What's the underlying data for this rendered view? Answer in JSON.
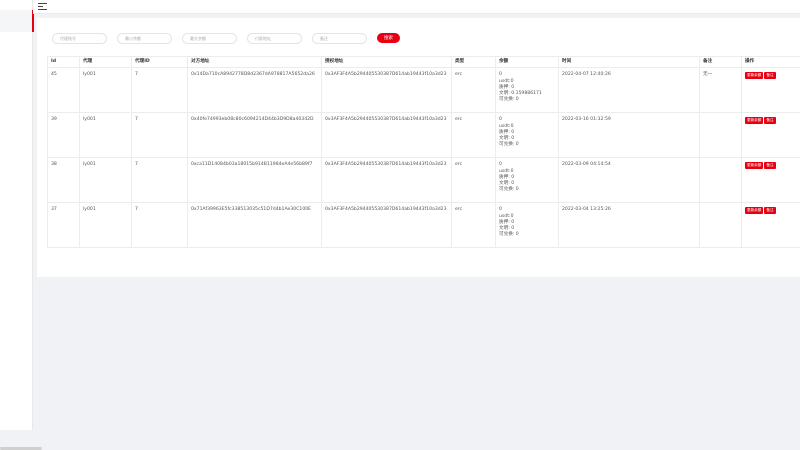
{
  "filters": {
    "agent_account_placeholder": "代理账号",
    "min_amount_placeholder": "最小余额",
    "max_amount_placeholder": "最大余额",
    "pay_address_placeholder": "付款地址",
    "remark_placeholder": "备注",
    "search_label": "搜索"
  },
  "table": {
    "columns": [
      "Id",
      "代理",
      "代理ID",
      "对方地址",
      "授权地址",
      "类型",
      "余额",
      "时间",
      "备注",
      "操作"
    ],
    "rows": [
      {
        "id": "45",
        "agent": "ly001",
        "agent_id": "7",
        "peer_address": "0x14Da710cA8942778D8d2367dA978817A5652da26",
        "auth_address": "0x3AF3F4A5b294405530387D614ab19443f10a3d23",
        "type": "erc",
        "balance": [
          "0",
          "usdt:0",
          "质押: 0",
          "文明: 0.159886171",
          "可兑换: 0"
        ],
        "time": "2022-04-07 12:40:26",
        "remark": "无一",
        "actions": [
          "更新余额",
          "备注"
        ]
      },
      {
        "id": "39",
        "agent": "ly001",
        "agent_id": "7",
        "peer_address": "0x40fe74993eb08c80c6094214D44b3D9D8a40342D",
        "auth_address": "0x3AF3F4A5b294405530387D614ab19443f10a3d23",
        "type": "erc",
        "balance": [
          "0",
          "usdt:0",
          "质押: 0",
          "文明: 0",
          "可兑换: 0"
        ],
        "time": "2022-03-16 01:32:59",
        "remark": "",
        "actions": [
          "更新余额",
          "备注"
        ]
      },
      {
        "id": "38",
        "agent": "ly001",
        "agent_id": "7",
        "peer_address": "0xca11D14084b03a18015b914B11984eA4e56b89f7",
        "auth_address": "0x3AF3F4A5b294405530387D614ab19443f10a3d23",
        "type": "erc",
        "balance": [
          "0",
          "usdt:0",
          "质押: 0",
          "文明: 0",
          "可兑换: 0"
        ],
        "time": "2022-03-09 04:14:54",
        "remark": "",
        "actions": [
          "更新余额",
          "备注"
        ]
      },
      {
        "id": "37",
        "agent": "ly001",
        "agent_id": "7",
        "peer_address": "0x71Af39963E5fc338513035c51D7d4b1Ae30C100E",
        "auth_address": "0x3AF3F4A5b294405530387D614ab19443f10a3d23",
        "type": "erc",
        "balance": [
          "0",
          "usdt:0",
          "质押: 0",
          "文明: 0",
          "可兑换: 0"
        ],
        "time": "2022-03-04 13:25:26",
        "remark": "",
        "actions": [
          "更新余额",
          "备注"
        ]
      }
    ]
  },
  "colors": {
    "accent": "#e60012",
    "background": "#f0f2f5",
    "panel": "#ffffff"
  },
  "icons": {
    "menu": "hamburger-menu-icon"
  }
}
